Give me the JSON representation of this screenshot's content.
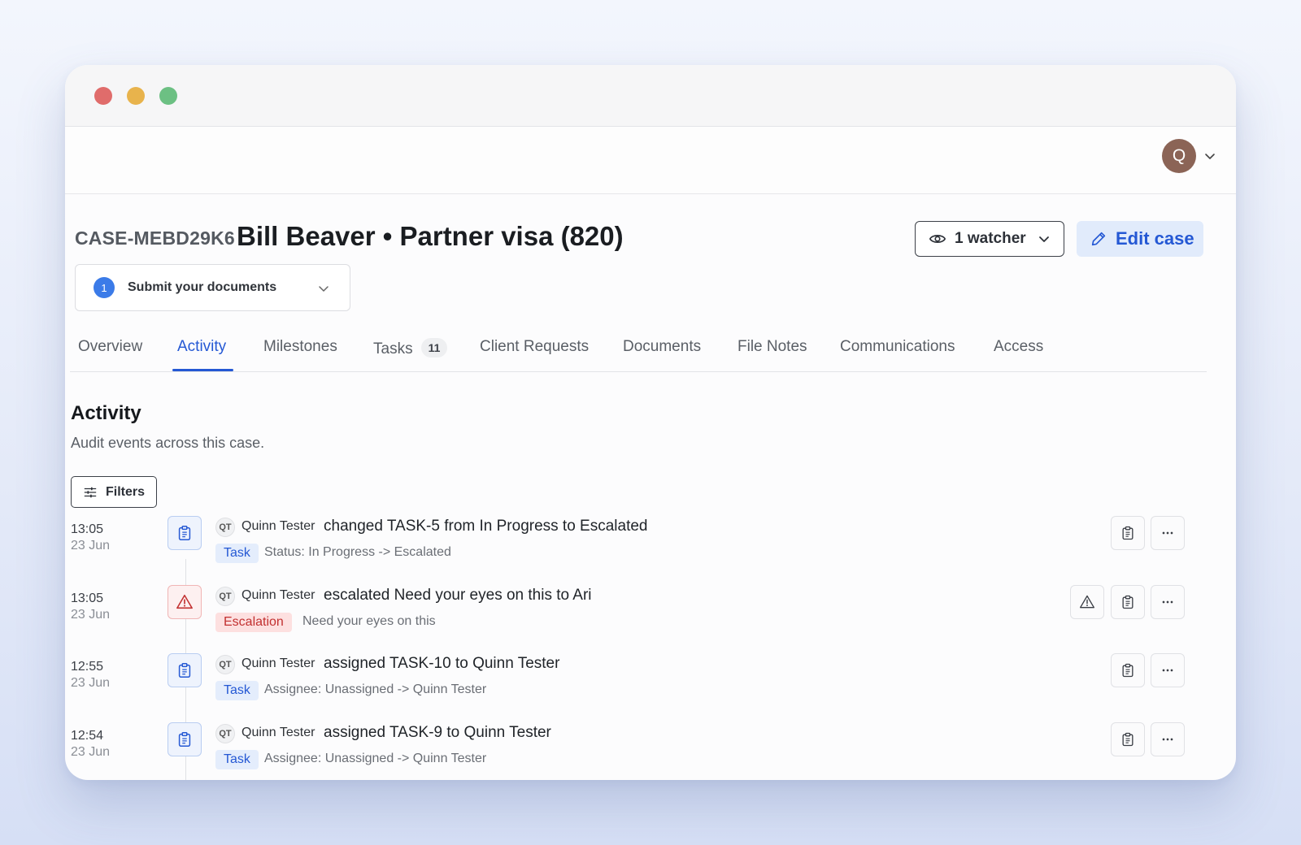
{
  "user": {
    "avatar_initial": "Q"
  },
  "case": {
    "id": "CASE-MEBD29K6",
    "title": "Bill Beaver • Partner visa (820)",
    "watchers_label": "1 watcher",
    "edit_label": "Edit case",
    "stage": {
      "number": "1",
      "label": "Submit your documents"
    }
  },
  "tabs": [
    {
      "label": "Overview"
    },
    {
      "label": "Activity",
      "active": true
    },
    {
      "label": "Milestones"
    },
    {
      "label": "Tasks",
      "badge": "11"
    },
    {
      "label": "Client Requests"
    },
    {
      "label": "Documents"
    },
    {
      "label": "File Notes"
    },
    {
      "label": "Communications"
    },
    {
      "label": "Access"
    }
  ],
  "activity": {
    "title": "Activity",
    "subtitle": "Audit events across this case.",
    "filters_label": "Filters",
    "events": [
      {
        "time": "13:05",
        "date": "23 Jun",
        "icon": "clipboard-icon",
        "actor_initials": "QT",
        "actor": "Quinn Tester",
        "summary": "changed TASK-5 from In Progress to Escalated",
        "tag": "Task",
        "detail": "Status: In Progress -> Escalated"
      },
      {
        "time": "13:05",
        "date": "23 Jun",
        "icon": "alert-triangle-icon",
        "actor_initials": "QT",
        "actor": "Quinn Tester",
        "summary": "escalated Need your eyes on this to Ari",
        "tag": "Escalation",
        "detail": "Need your eyes on this"
      },
      {
        "time": "12:55",
        "date": "23 Jun",
        "icon": "clipboard-icon",
        "actor_initials": "QT",
        "actor": "Quinn Tester",
        "summary": "assigned TASK-10 to Quinn Tester",
        "tag": "Task",
        "detail": "Assignee: Unassigned -> Quinn Tester"
      },
      {
        "time": "12:54",
        "date": "23 Jun",
        "icon": "clipboard-icon",
        "actor_initials": "QT",
        "actor": "Quinn Tester",
        "summary": "assigned TASK-9 to Quinn Tester",
        "tag": "Task",
        "detail": "Assignee: Unassigned -> Quinn Tester"
      }
    ]
  },
  "colors": {
    "accent": "#2458d4",
    "escalation": "#c23030",
    "avatar": "#8b6456"
  }
}
